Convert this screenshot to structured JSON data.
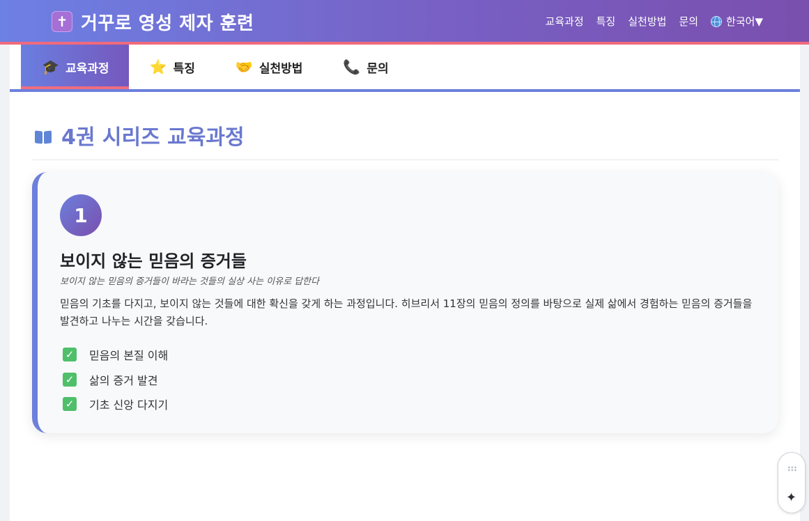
{
  "header": {
    "brand_icon": "cross-icon",
    "title": "거꾸로 영성 제자 훈련",
    "nav": [
      "교육과정",
      "특징",
      "실천방법",
      "문의"
    ],
    "language": "한국어",
    "language_caret": "▼"
  },
  "tabs": [
    {
      "icon": "graduation-cap-icon",
      "glyph": "🎓",
      "label": "교육과정",
      "active": true
    },
    {
      "icon": "star-icon",
      "glyph": "⭐",
      "label": "특징",
      "active": false
    },
    {
      "icon": "handshake-icon",
      "glyph": "🤝",
      "label": "실천방법",
      "active": false
    },
    {
      "icon": "phone-icon",
      "glyph": "📞",
      "label": "문의",
      "active": false
    }
  ],
  "section": {
    "icon": "book-icon",
    "title": "4권 시리즈 교육과정"
  },
  "course": {
    "number": "1",
    "title": "보이지 않는 믿음의 증거들",
    "subtitle": "보이지 않는 믿음의 증거들이 바라는 것들의 실상 사는 이유로 답한다",
    "description": "믿음의 기초를 다지고, 보이지 않는 것들에 대한 확신을 갖게 하는 과정입니다. 히브리서 11장의 믿음의 정의를 바탕으로 실제 삶에서 경험하는 믿음의 증거들을 발견하고 나누는 시간을 갖습니다.",
    "check_glyph": "✓",
    "checklist": [
      "믿음의 본질 이해",
      "삶의 증거 발견",
      "기초 신앙 다지기"
    ]
  },
  "colors": {
    "header_gradient": [
      "#6d80e4",
      "#7a4fae"
    ],
    "accent": "#6c7fdc",
    "highlight": "#f06a7c",
    "check": "#4fbf6a"
  },
  "floating_widget": {
    "icons": [
      "grip-icon",
      "sparkle-icon"
    ],
    "sparkle_glyph": "✦"
  }
}
